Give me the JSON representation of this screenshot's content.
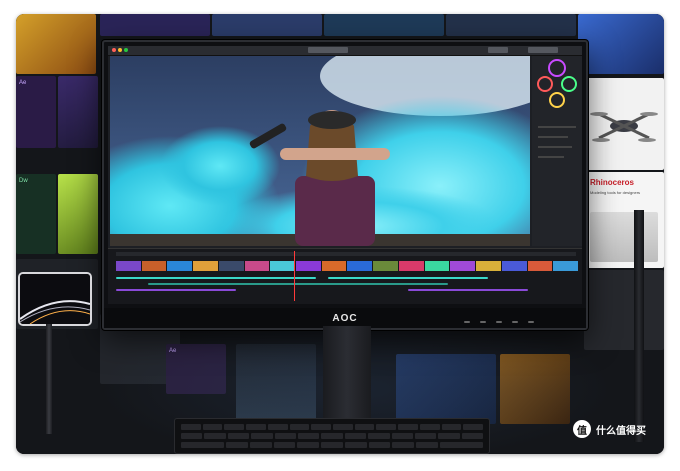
{
  "scene": {
    "monitor_brand": "AOC",
    "watermark_text": "什么值得买",
    "watermark_icon": "zhi-badge-icon",
    "background_color": "#1b1c20",
    "accent_cyan": "#2fd4e8",
    "accent_purple": "#7a48c8"
  },
  "wall_panels": [
    {
      "name": "Ae",
      "icon": "after-effects-icon"
    },
    {
      "name": "Dw",
      "icon": "dreamweaver-icon"
    },
    {
      "name": "Ae",
      "icon": "after-effects-icon"
    }
  ],
  "side_ad": {
    "brand": "Rhinoceros",
    "tagline": "Modeling tools for designers"
  }
}
